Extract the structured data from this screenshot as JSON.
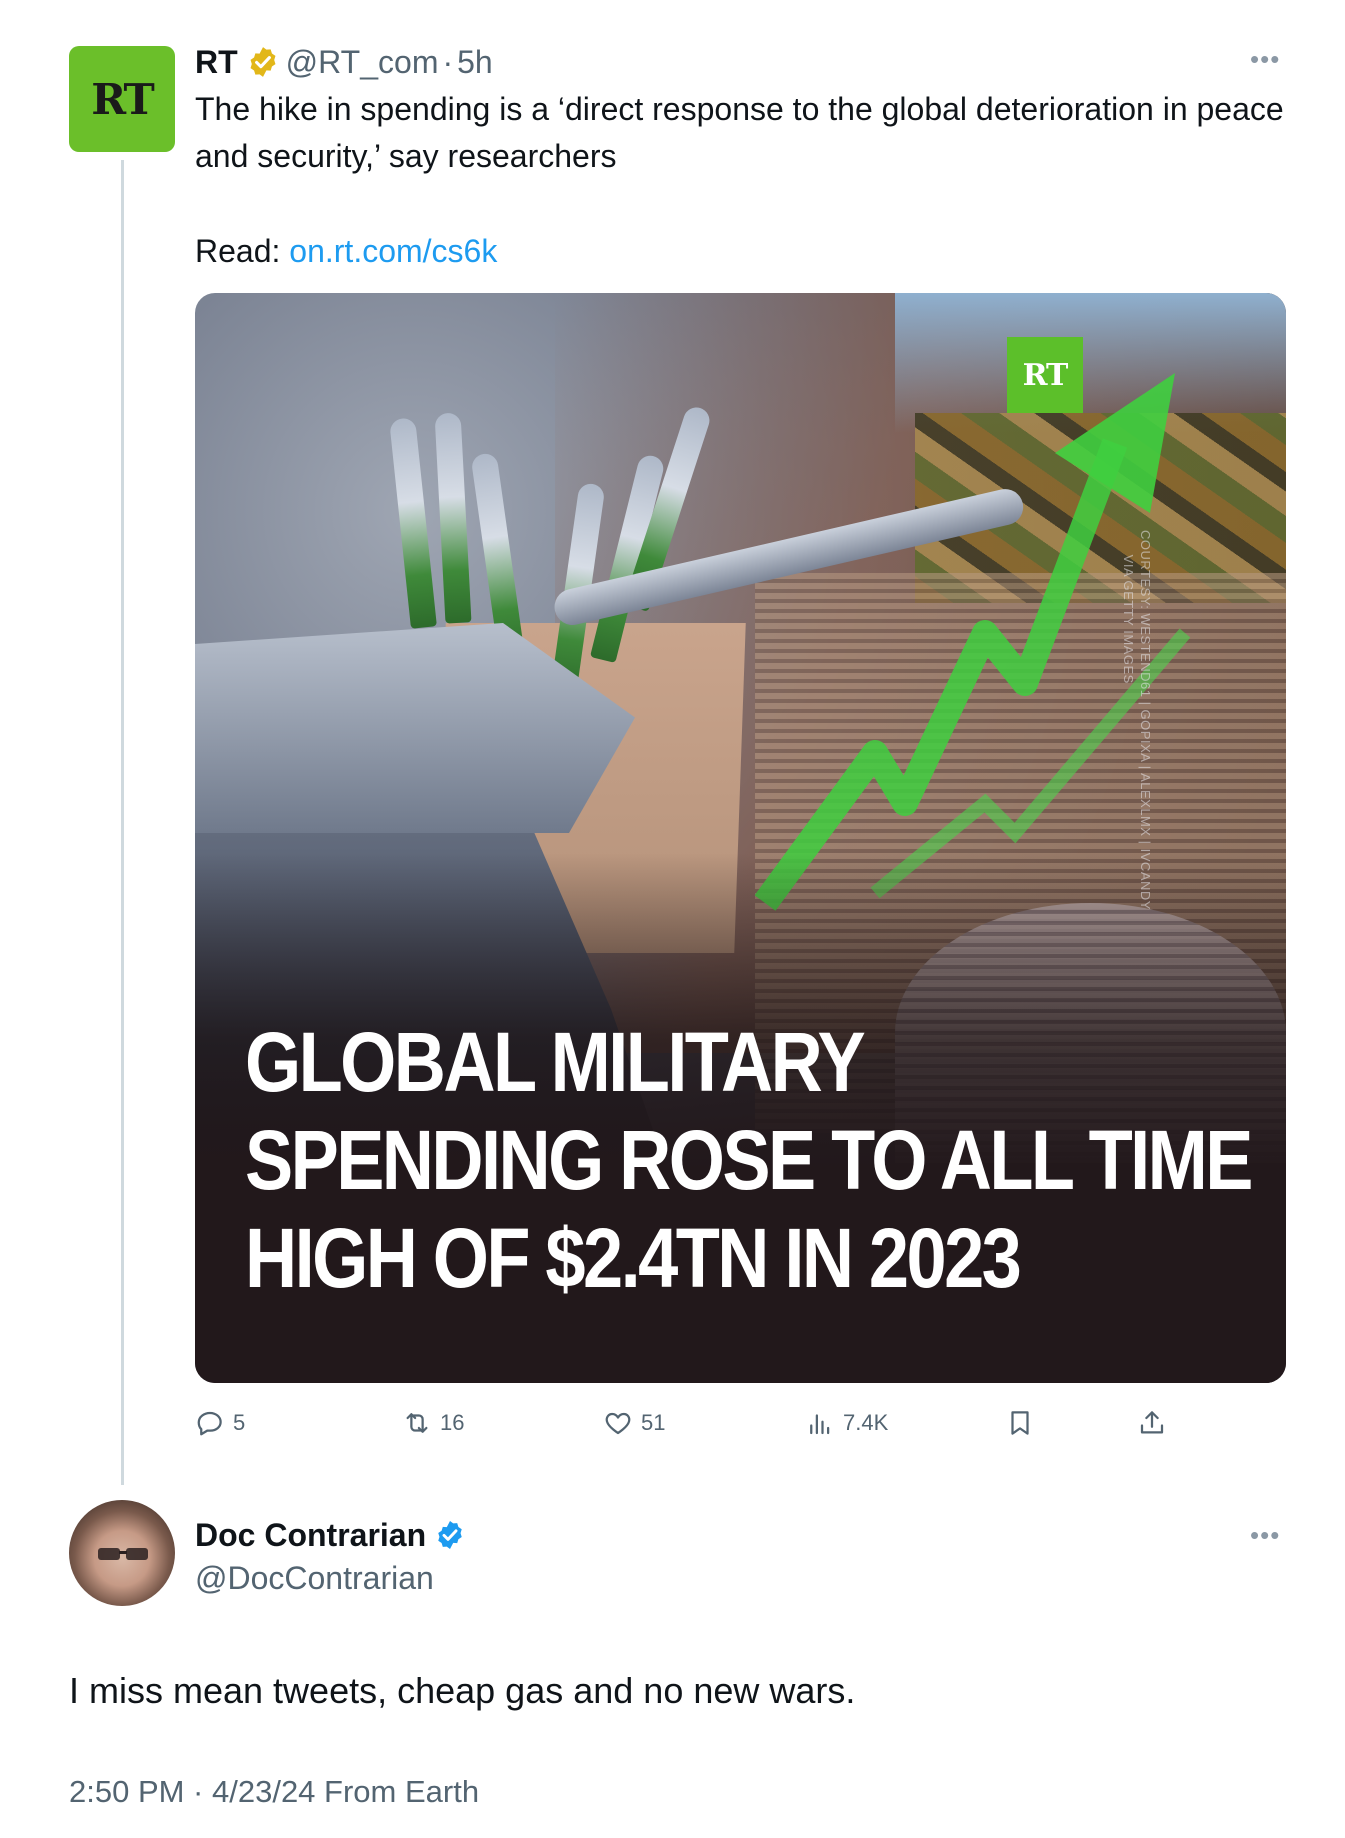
{
  "tweet": {
    "author_name": "RT",
    "handle": "@RT_com",
    "separator": "·",
    "time": "5h",
    "avatar_text": "RT",
    "body": "The hike in spending is a ‘direct response to the global deterioration in peace and security,’ say researchers",
    "read_label": "Read:",
    "link_text": "on.rt.com/cs6k",
    "media": {
      "logo_text": "RT",
      "photo_credit": "COURTESY: WESTEND61 | GOPIXA | ALEXLMX | IVCANDY\n      VIA GETTY IMAGES",
      "headline_lines": [
        "GLOBAL MILITARY",
        "SPENDING ROSE TO ALL TIME",
        "HIGH OF $2.4TN IN 2023"
      ]
    },
    "actions": {
      "replies": "5",
      "reposts": "16",
      "likes": "51",
      "views": "7.4K"
    }
  },
  "reply": {
    "author_name": "Doc Contrarian",
    "handle": "@DocContrarian",
    "body": "I miss mean tweets, cheap gas and no new wars.",
    "meta": "2:50 PM · 4/23/24 From Earth"
  },
  "icons": {
    "more": "more-icon",
    "verified_gold": "verified-gold-icon",
    "verified_blue": "verified-blue-icon",
    "reply": "reply-icon",
    "repost": "repost-icon",
    "like": "heart-icon",
    "views": "views-icon",
    "bookmark": "bookmark-icon",
    "share": "share-icon"
  },
  "colors": {
    "link": "#1d9bf0",
    "secondary_text": "#536471",
    "rt_green": "#6bbf2a",
    "verified_gold": "#e2b719",
    "verified_blue": "#1d9bf0",
    "thread_line": "#cfd9de"
  }
}
